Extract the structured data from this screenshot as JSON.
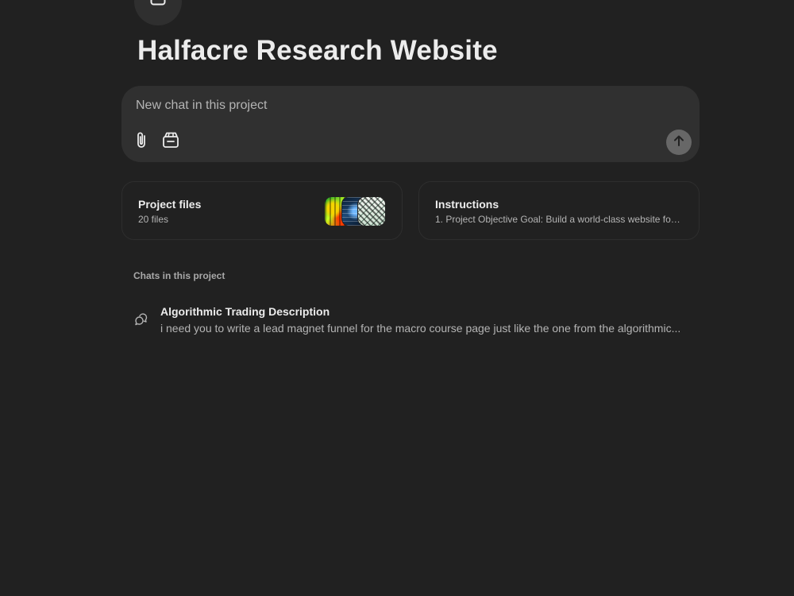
{
  "project": {
    "title": "Halfacre Research Website",
    "icon": "folder-icon"
  },
  "composer": {
    "placeholder": "New chat in this project",
    "attach_icon": "paperclip-icon",
    "tools_icon": "project-tools-icon",
    "send_icon": "arrow-up-icon"
  },
  "cards": {
    "files": {
      "title": "Project files",
      "subtitle": "20 files"
    },
    "instructions": {
      "title": "Instructions",
      "subtitle": "1. Project Objective Goal: Build a world-class website for ..."
    }
  },
  "chats": {
    "section_label": "Chats in this project",
    "items": [
      {
        "title": "Algorithmic Trading Description",
        "snippet": "i need you to write a lead magnet funnel for the macro course page just like the one from the algorithmic...",
        "icon": "chat-bubbles-icon"
      }
    ]
  },
  "colors": {
    "background": "#212121",
    "surface": "#303030",
    "text_primary": "#ececec",
    "text_secondary": "#b4b4b4",
    "send_button": "#676767"
  }
}
